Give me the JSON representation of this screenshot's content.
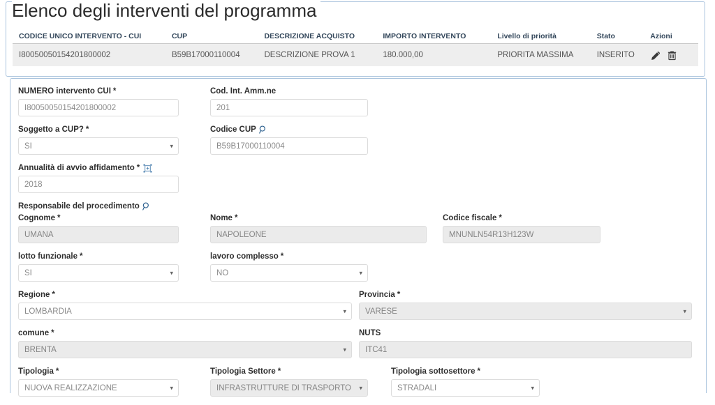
{
  "page": {
    "title": "Elenco degli interventi del programma"
  },
  "table": {
    "columns": [
      "CODICE UNICO INTERVENTO - CUI",
      "CUP",
      "DESCRIZIONE ACQUISTO",
      "IMPORTO INTERVENTO",
      "Livello di priorità",
      "Stato",
      "Azioni"
    ],
    "rows": [
      {
        "cui": "I80050050154201800002",
        "cup": "B59B17000110004",
        "descrizione": "DESCRIZIONE PROVA 1",
        "importo": "180.000,00",
        "priorita": "PRIORITA MASSIMA",
        "stato": "INSERITO",
        "actions": [
          "edit-icon",
          "delete-icon"
        ]
      }
    ]
  },
  "form": {
    "numero_intervento_cui": {
      "label": "NUMERO intervento CUI",
      "required": "*",
      "value": "I80050050154201800002"
    },
    "cod_int_ammne": {
      "label": "Cod. Int. Amm.ne",
      "required": "",
      "value": "201"
    },
    "soggetto_a_cup": {
      "label": "Soggetto a CUP?",
      "required": "*",
      "value": "SI"
    },
    "codice_cup": {
      "label": "Codice CUP",
      "required": "",
      "icon": "search-icon",
      "value": "B59B17000110004"
    },
    "annualita_avvio_affidamento": {
      "label": "Annualità di avvio affidamento",
      "required": "*",
      "icon": "frame-picker-icon",
      "value": "2018"
    },
    "responsabile_procedimento": {
      "label": "Responsabile del procedimento",
      "icon": "search-icon"
    },
    "cognome": {
      "label": "Cognome",
      "required": "*",
      "value": "UMANA"
    },
    "nome": {
      "label": "Nome",
      "required": "*",
      "value": "NAPOLEONE"
    },
    "codice_fiscale": {
      "label": "Codice fiscale",
      "required": "*",
      "value": "MNUNLN54R13H123W"
    },
    "lotto_funzionale": {
      "label": "lotto funzionale",
      "required": "*",
      "value": "SI"
    },
    "lavoro_complesso": {
      "label": "lavoro complesso",
      "required": "*",
      "value": "NO"
    },
    "regione": {
      "label": "Regione",
      "required": "*",
      "value": "LOMBARDIA"
    },
    "provincia": {
      "label": "Provincia",
      "required": "*",
      "value": "VARESE"
    },
    "comune": {
      "label": "comune",
      "required": "*",
      "value": "BRENTA"
    },
    "nuts": {
      "label": "NUTS",
      "required": "",
      "value": "ITC41"
    },
    "tipologia": {
      "label": "Tipologia",
      "required": "*",
      "value": "NUOVA REALIZZAZIONE"
    },
    "tipologia_settore": {
      "label": "Tipologia Settore",
      "required": "*",
      "value": "INFRASTRUTTURE DI TRASPORTO"
    },
    "tipologia_sottosettore": {
      "label": "Tipologia sottosettore",
      "required": "*",
      "value": "STRADALI"
    }
  },
  "colors": {
    "panel_border": "#a9c3dd",
    "header_text": "#33475b",
    "row_bg": "#eeeeee",
    "disabled_bg": "#ebebeb",
    "icon_blue": "#2b5f8e"
  }
}
